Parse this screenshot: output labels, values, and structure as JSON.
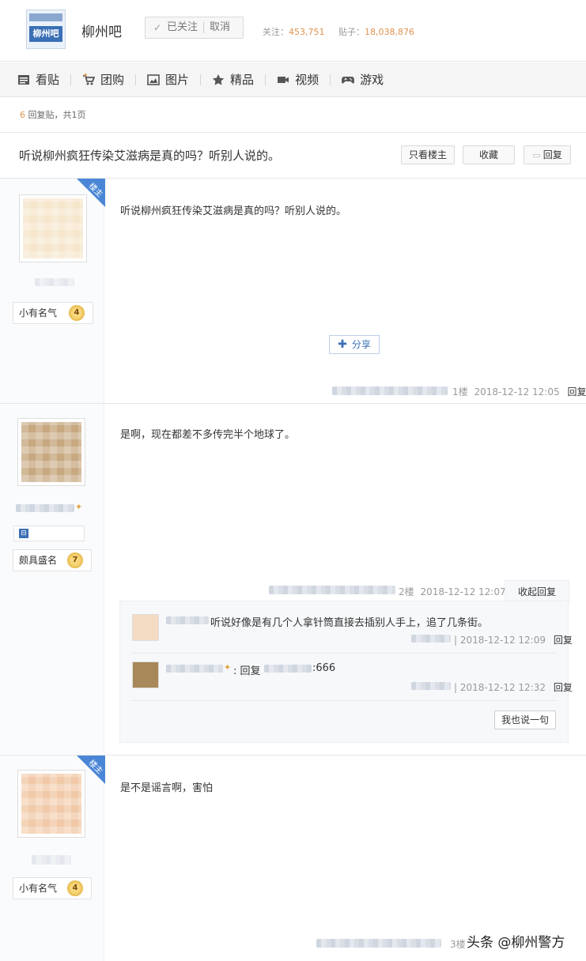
{
  "header": {
    "logo_text": "柳州吧",
    "bar_name": "柳州吧",
    "follow_label": "已关注",
    "cancel_label": "取消",
    "follow_count_label": "关注：",
    "follow_count": "453,751",
    "post_count_label": "贴子：",
    "post_count": "18,038,876"
  },
  "nav": {
    "items": [
      {
        "label": "看贴",
        "icon": "list-icon"
      },
      {
        "label": "团购",
        "icon": "cart-icon"
      },
      {
        "label": "图片",
        "icon": "image-icon"
      },
      {
        "label": "精品",
        "icon": "star-icon"
      },
      {
        "label": "视频",
        "icon": "video-icon"
      },
      {
        "label": "游戏",
        "icon": "gamepad-icon"
      }
    ]
  },
  "thread": {
    "reply_count": "6",
    "reply_count_suffix": "回复贴，共1页",
    "title": "听说柳州疯狂传染艾滋病是真的吗？听别人说的。",
    "btn_only_op": "只看楼主",
    "btn_favorite": "收藏",
    "btn_reply": "回复"
  },
  "posts": [
    {
      "op_badge": "楼主",
      "level_name": "小有名气",
      "level": "4",
      "content": "听说柳州疯狂传染艾滋病是真的吗？听别人说的。",
      "share_label": "分享",
      "floor": "1楼",
      "time": "2018-12-12 12:05",
      "reply_label": "回复"
    },
    {
      "level_name": "颇具盛名",
      "level": "7",
      "content": "是啊，现在都差不多传完半个地球了。",
      "floor": "2楼",
      "time": "2018-12-12 12:07",
      "collapse_label": "收起回复",
      "sub_replies": [
        {
          "content": "听说好像是有几个人拿针筒直接去插别人手上，追了几条街。",
          "time": "2018-12-12 12:09",
          "reply_label": "回复"
        },
        {
          "prefix": ": 回复",
          "content": ":666",
          "time": "2018-12-12 12:32",
          "reply_label": "回复"
        }
      ],
      "say_label": "我也说一句"
    },
    {
      "op_badge": "楼主",
      "level_name": "小有名气",
      "level": "4",
      "content": "是不是谣言啊，害怕",
      "floor": "3楼"
    }
  ],
  "watermark": "头条 @柳州警方"
}
